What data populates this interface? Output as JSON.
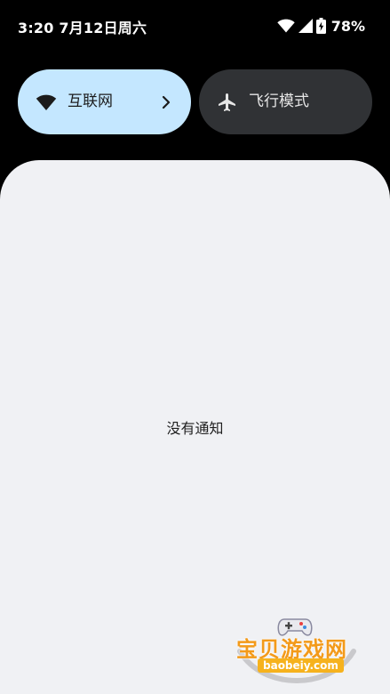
{
  "status_bar": {
    "time_date": "3:20 7月12日周六",
    "battery_percent": "78%",
    "icons": [
      "wifi-icon",
      "signal-icon",
      "battery-charging-icon"
    ]
  },
  "quick_settings": {
    "internet": {
      "label": "互联网",
      "icon": "wifi-icon",
      "active": true,
      "color": "#c4e7ff"
    },
    "airplane": {
      "label": "飞行模式",
      "icon": "airplane-icon",
      "active": false,
      "color": "#303235"
    }
  },
  "notifications": {
    "empty_text": "没有通知",
    "background_color": "#f0f1f4"
  },
  "watermark": {
    "title": "宝贝游戏网",
    "url": "baobeiy.com"
  }
}
